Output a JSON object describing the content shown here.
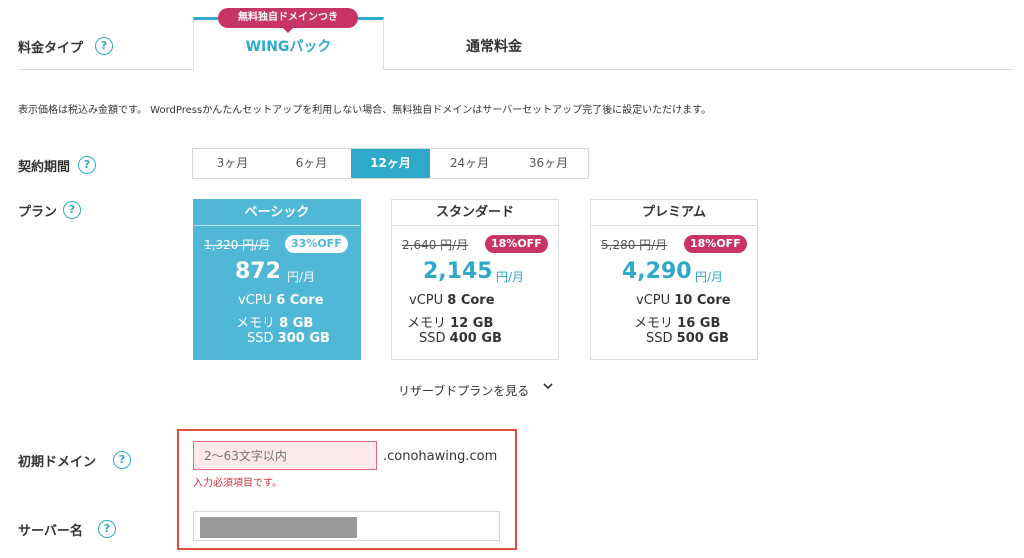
{
  "pricing_type": {
    "label": "料金タイプ",
    "tabs": [
      {
        "label": "WINGパック",
        "badge": "無料独自ドメインつき",
        "active": true
      },
      {
        "label": "通常料金",
        "active": false
      }
    ]
  },
  "notice": "表示価格は税込み金額です。 WordPressかんたんセットアップを利用しない場合、無料独自ドメインはサーバーセットアップ完了後に設定いただけます。",
  "contract_period": {
    "label": "契約期間",
    "options": [
      "3ヶ月",
      "6ヶ月",
      "12ヶ月",
      "24ヶ月",
      "36ヶ月"
    ],
    "selected": "12ヶ月"
  },
  "plan": {
    "label": "プラン",
    "items": [
      {
        "name": "ベーシック",
        "old_price": "1,320 円/月",
        "discount": "33%OFF",
        "price": "872",
        "unit": "円/月",
        "vcpu_label": "vCPU",
        "vcpu": "6 Core",
        "memory_label": "メモリ",
        "memory": "8 GB",
        "ssd_label": "SSD",
        "ssd": "300 GB",
        "selected": true
      },
      {
        "name": "スタンダード",
        "old_price": "2,640 円/月",
        "discount": "18%OFF",
        "price": "2,145",
        "unit": "円/月",
        "vcpu_label": "vCPU",
        "vcpu": "8 Core",
        "memory_label": "メモリ",
        "memory": "12 GB",
        "ssd_label": "SSD",
        "ssd": "400 GB",
        "selected": false
      },
      {
        "name": "プレミアム",
        "old_price": "5,280 円/月",
        "discount": "18%OFF",
        "price": "4,290",
        "unit": "円/月",
        "vcpu_label": "vCPU",
        "vcpu": "10 Core",
        "memory_label": "メモリ",
        "memory": "16 GB",
        "ssd_label": "SSD",
        "ssd": "500 GB",
        "selected": false
      }
    ],
    "reserved_link": "リザーブドプランを見る"
  },
  "initial_domain": {
    "label": "初期ドメイン",
    "placeholder": "2〜63文字以内",
    "suffix": ".conohawing.com",
    "error": "入力必須項目です。"
  },
  "server_name": {
    "label": "サーバー名",
    "value": ""
  },
  "colors": {
    "accent": "#2fa9c9",
    "selected_plan_bg": "#51b7d6",
    "badge_pink": "#c93467",
    "error_red": "#d0303a",
    "highlight_frame": "#e0503a"
  }
}
